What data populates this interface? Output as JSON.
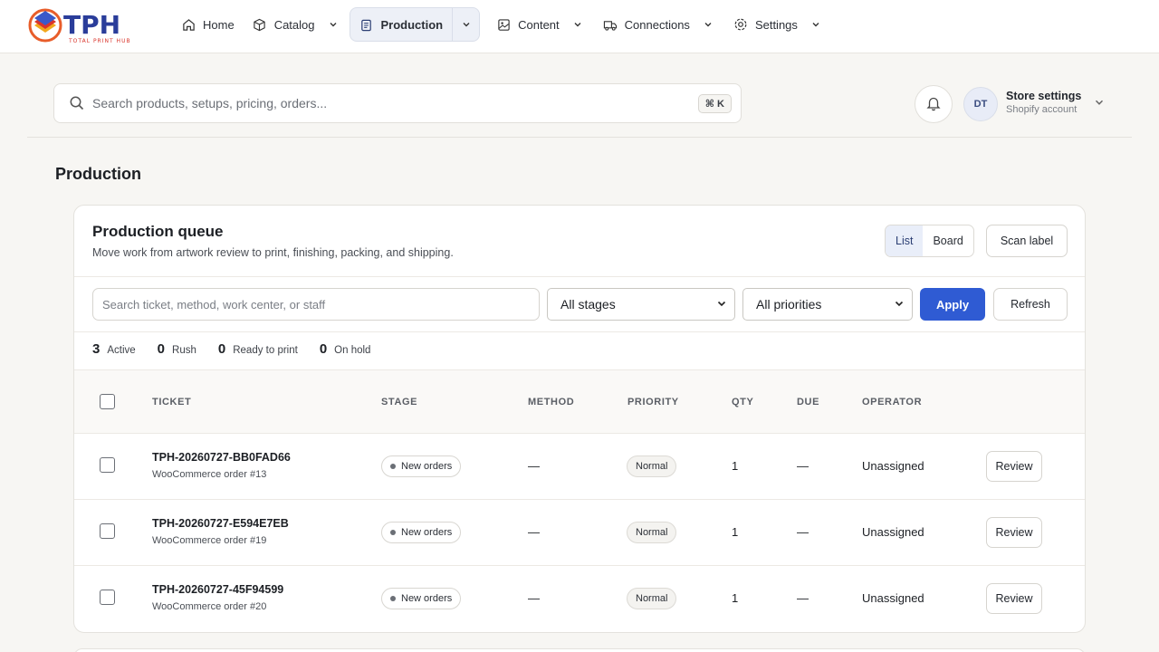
{
  "brand": {
    "name": "TPH",
    "tagline": "TOTAL PRINT HUB"
  },
  "nav": {
    "home": "Home",
    "catalog": "Catalog",
    "production": "Production",
    "content": "Content",
    "connections": "Connections",
    "settings": "Settings"
  },
  "search": {
    "placeholder": "Search products, setups, pricing, orders...",
    "shortcut": "⌘ K"
  },
  "account": {
    "initials": "DT",
    "title": "Store settings",
    "subtitle": "Shopify account"
  },
  "page": {
    "title": "Production"
  },
  "queue": {
    "title": "Production queue",
    "subtitle": "Move work from artwork review to print, finishing, packing, and shipping.",
    "view_list": "List",
    "view_board": "Board",
    "scan_label": "Scan label",
    "filter_placeholder": "Search ticket, method, work center, or staff",
    "stage_select": "All stages",
    "priority_select": "All priorities",
    "apply": "Apply",
    "refresh": "Refresh"
  },
  "stats": [
    {
      "n": "3",
      "label": "Active"
    },
    {
      "n": "0",
      "label": "Rush"
    },
    {
      "n": "0",
      "label": "Ready to print"
    },
    {
      "n": "0",
      "label": "On hold"
    }
  ],
  "columns": {
    "ticket": "TICKET",
    "stage": "STAGE",
    "method": "METHOD",
    "priority": "PRIORITY",
    "qty": "QTY",
    "due": "DUE",
    "operator": "OPERATOR"
  },
  "rows": [
    {
      "ticket": "TPH-20260727-BB0FAD66",
      "source": "WooCommerce order #13",
      "stage": "New orders",
      "method": "—",
      "priority": "Normal",
      "qty": "1",
      "due": "—",
      "operator": "Unassigned",
      "action": "Review"
    },
    {
      "ticket": "TPH-20260727-E594E7EB",
      "source": "WooCommerce order #19",
      "stage": "New orders",
      "method": "—",
      "priority": "Normal",
      "qty": "1",
      "due": "—",
      "operator": "Unassigned",
      "action": "Review"
    },
    {
      "ticket": "TPH-20260727-45F94599",
      "source": "WooCommerce order #20",
      "stage": "New orders",
      "method": "—",
      "priority": "Normal",
      "qty": "1",
      "due": "—",
      "operator": "Unassigned",
      "action": "Review"
    }
  ],
  "colors": {
    "accent": "#2f5bd3",
    "active_nav_bg": "#edf0f7"
  }
}
